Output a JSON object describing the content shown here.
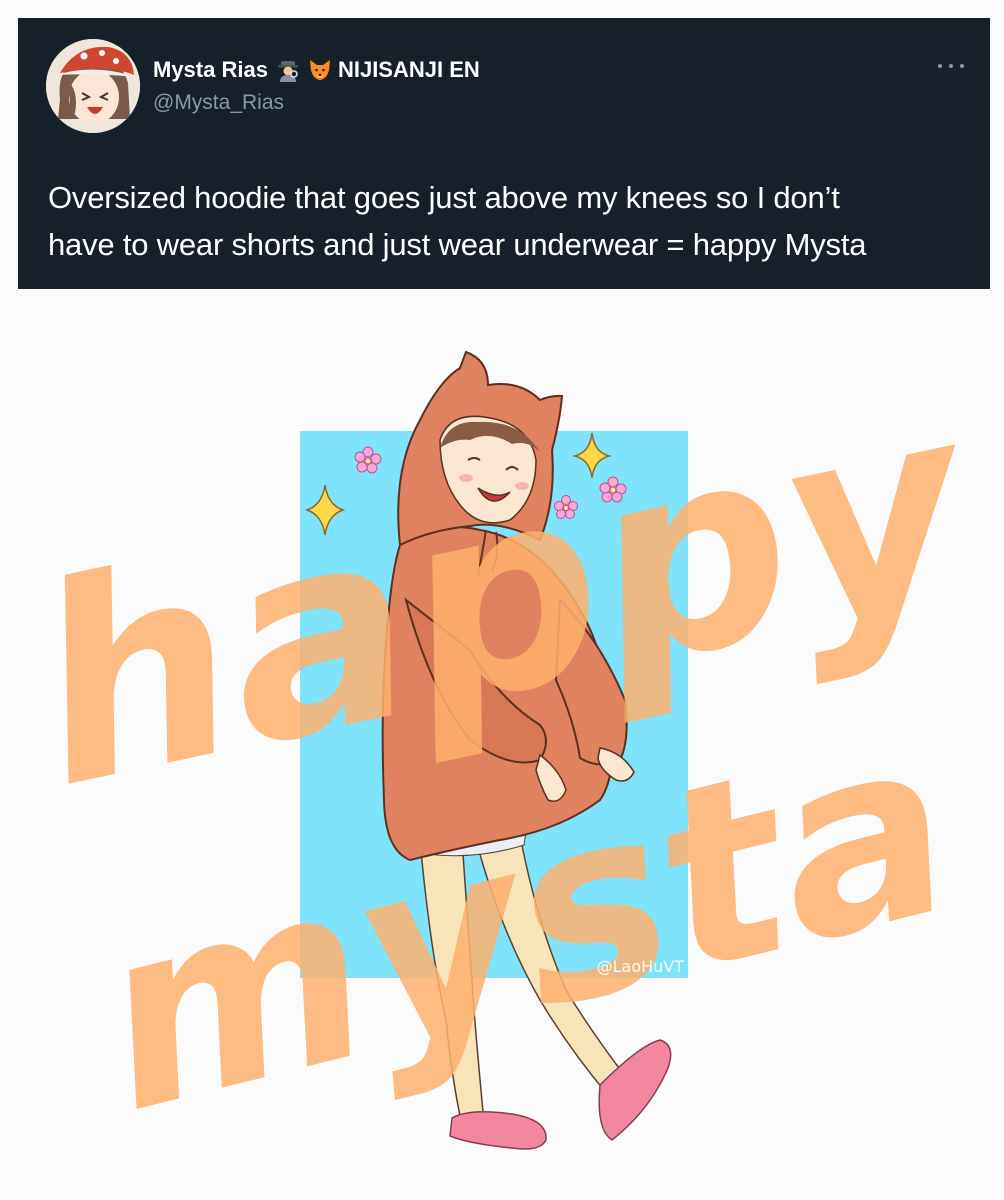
{
  "tweet": {
    "display_name": "Mysta Rias",
    "name_emojis": [
      "detective-emoji",
      "fox-emoji"
    ],
    "affiliation": "NIJISANJI EN",
    "handle": "@Mysta_Rias",
    "text_line_1": "Oversized hoodie that goes just above my knees so I don’t",
    "text_line_2": "have to wear shorts and just wear underwear = happy Mysta",
    "more_icon": "more-horizontal-icon"
  },
  "artwork": {
    "overlay_word_1": "happy",
    "overlay_word_2": "mysta",
    "artist_signature": "@LaoHuVT",
    "colors": {
      "background": "#fbfbfb",
      "panel": "#7ee3fb",
      "hoodie": "#e0825f",
      "overlay": "#ffb06e",
      "slippers": "#f2879f"
    }
  }
}
